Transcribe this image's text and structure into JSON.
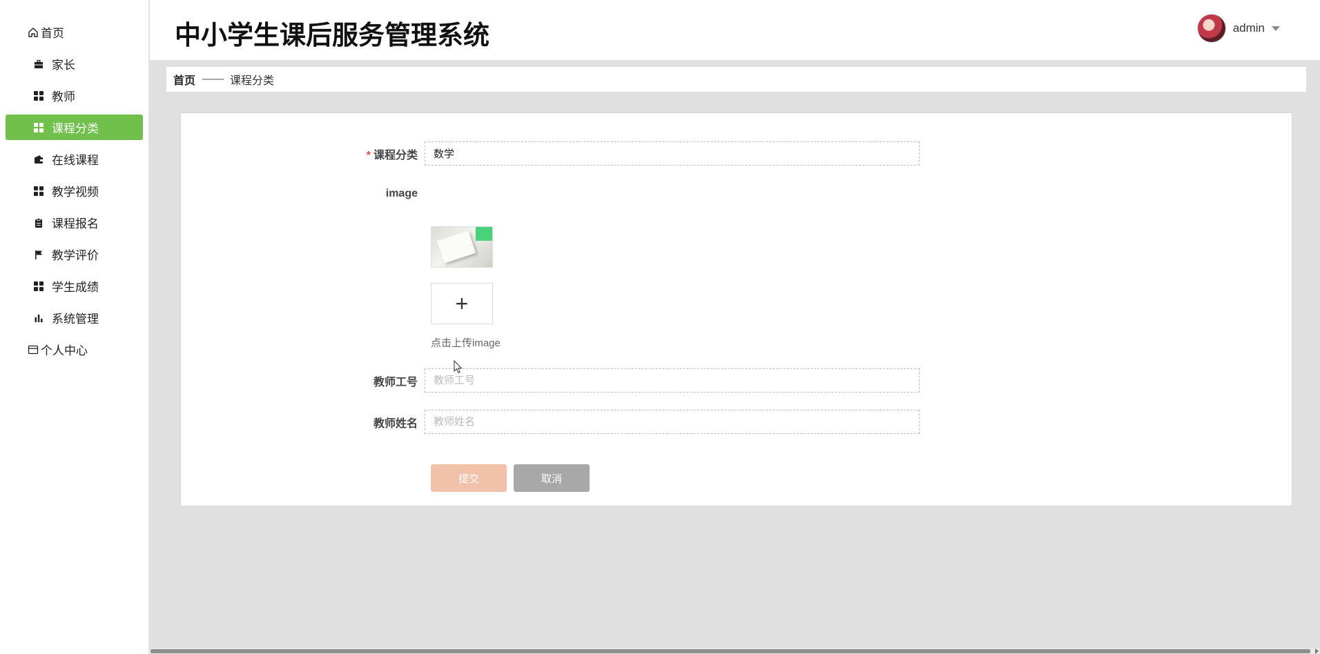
{
  "sidebar": {
    "items": [
      {
        "label": "首页",
        "icon": "home-icon",
        "active": false
      },
      {
        "label": "家长",
        "icon": "briefcase-icon",
        "active": false
      },
      {
        "label": "教师",
        "icon": "grid-icon",
        "active": false
      },
      {
        "label": "课程分类",
        "icon": "grid-icon",
        "active": true
      },
      {
        "label": "在线课程",
        "icon": "wallet-icon",
        "active": false
      },
      {
        "label": "教学视频",
        "icon": "grid-icon",
        "active": false
      },
      {
        "label": "课程报名",
        "icon": "clipboard-icon",
        "active": false
      },
      {
        "label": "教学评价",
        "icon": "flag-icon",
        "active": false
      },
      {
        "label": "学生成绩",
        "icon": "grid-icon",
        "active": false
      },
      {
        "label": "系统管理",
        "icon": "bar-chart-icon",
        "active": false
      },
      {
        "label": "个人中心",
        "icon": "card-icon",
        "active": false
      }
    ]
  },
  "header": {
    "title": "中小学生课后服务管理系统",
    "user": "admin"
  },
  "breadcrumb": {
    "home": "首页",
    "separator": "——",
    "current": "课程分类"
  },
  "form": {
    "category": {
      "required_mark": "*",
      "label": "课程分类",
      "value": "数学"
    },
    "image": {
      "label": "image",
      "upload_symbol": "+",
      "hint": "点击上传image"
    },
    "teacher_id": {
      "label": "教师工号",
      "placeholder": "教师工号",
      "value": ""
    },
    "teacher_name": {
      "label": "教师姓名",
      "placeholder": "教师姓名",
      "value": ""
    },
    "submit_label": "提交",
    "cancel_label": "取消"
  },
  "colors": {
    "accent": "#70c04b",
    "submit": "#f1c1aa",
    "cancel": "#a8a8a8",
    "required": "#e04b4b"
  }
}
